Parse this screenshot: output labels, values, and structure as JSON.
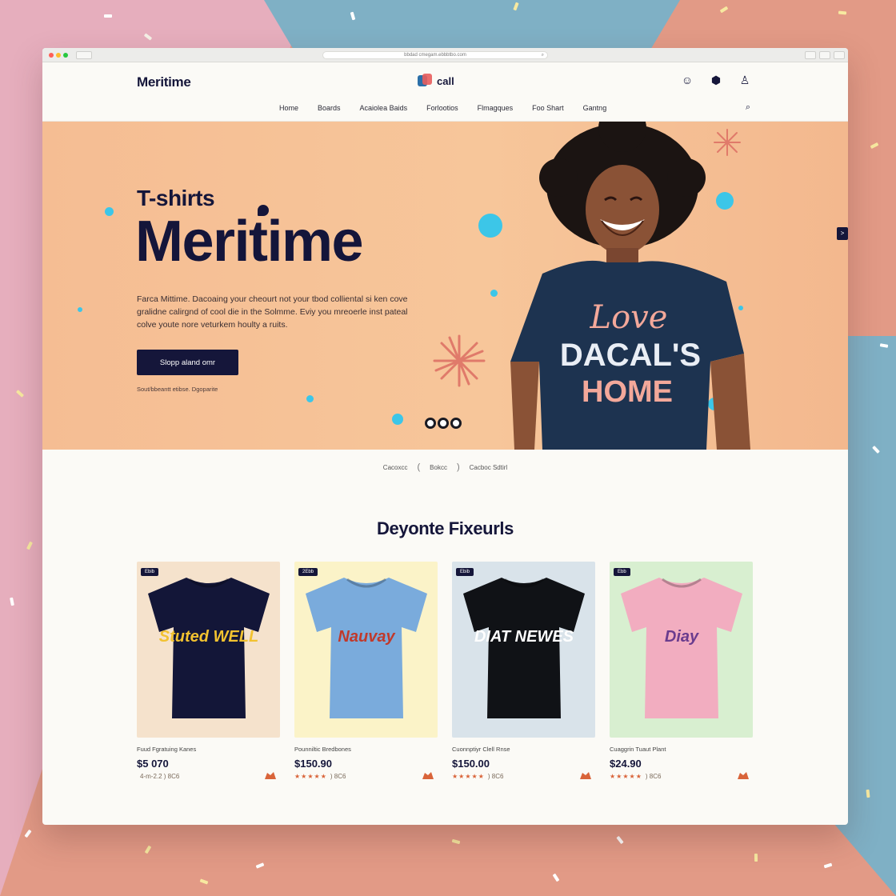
{
  "browser": {
    "url": "bbdad cmegam.ebbbtbo.com"
  },
  "header": {
    "logo": "Meritime",
    "brand_text": "call",
    "icons": [
      "user-icon",
      "bag-icon",
      "account-icon"
    ],
    "nav": [
      "Home",
      "Boards",
      "Acaiolea Baids",
      "Forlootios",
      "Flmagques",
      "Foo Shart",
      "Gantng"
    ]
  },
  "hero": {
    "kicker": "T-shirts",
    "title": "Meritime",
    "description": "Farca Mittime. Dacoaing your cheourt not your tbod colliental si ken cove gralidne calirgnd of cool die in the Solmme. Eviy you mreoerle inst pateal colve youte nore veturkem houlty a ruits.",
    "cta": "Slopp aland omr",
    "note": "Sout/bbeantt etibse. Dgoparite",
    "shirt_text_line1": "Love",
    "shirt_text_line2": "DACAL'S",
    "shirt_text_line3": "HOME",
    "colors": {
      "bubble": "#3cc6e8",
      "navy": "#15163a",
      "burst": "#e07a6a"
    }
  },
  "breadcrumb": [
    "Cacoxcc",
    "Bokcc",
    "Cacboc Sdtirl"
  ],
  "featured": {
    "title": "Deyonte Fixeurls",
    "products": [
      {
        "badge": "Ebib",
        "name": "Fuud Fgratuing Kanes",
        "price": "$5 070",
        "rating": "4-m-2.2 ) 8C6",
        "stars": "",
        "bg": "#f5e2cc",
        "shirt": "#131638",
        "print": "Stuted WELL",
        "print_color": "#f2c230"
      },
      {
        "badge": "2Ebb",
        "name": "Pounniltic Bredbones",
        "price": "$150.90",
        "rating": ") 8C6",
        "stars": "★★★★★",
        "bg": "#fbf3c8",
        "shirt": "#7aabdc",
        "print": "Nauvay",
        "print_color": "#c0392b"
      },
      {
        "badge": "Ebib",
        "name": "Cuonnptiyr Clell Rnse",
        "price": "$150.00",
        "rating": ") 8C6",
        "stars": "★★★★★",
        "bg": "#d9e3ea",
        "shirt": "#101216",
        "print": "DIAT NEWES",
        "print_color": "#ffffff"
      },
      {
        "badge": "Ebb",
        "name": "Cuaggrin Tuaut Plant",
        "price": "$24.90",
        "rating": ") 8C6",
        "stars": "★★★★★",
        "bg": "#d8efd0",
        "shirt": "#f2adc0",
        "print": "Diay",
        "print_color": "#6a3c8e"
      }
    ]
  }
}
